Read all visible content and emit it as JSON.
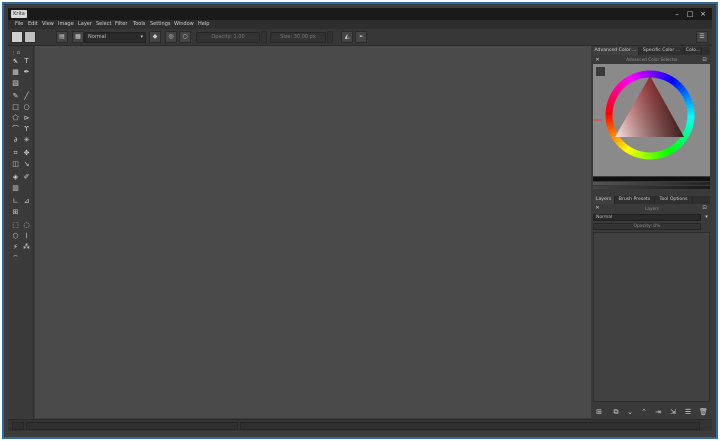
{
  "window": {
    "title": "Krita",
    "minimize_glyph": "–",
    "maximize_glyph": "□",
    "close_glyph": "×"
  },
  "menu": [
    "File",
    "Edit",
    "View",
    "Image",
    "Layer",
    "Select",
    "Filter",
    "Tools",
    "Settings",
    "Window",
    "Help"
  ],
  "toolbar": {
    "blend_mode": "Normal",
    "opacity_label": "Opacity:",
    "opacity_value": "1.00",
    "size_label": "Size:",
    "size_value": "30.00 px"
  },
  "dock_top": {
    "tabs": [
      "Advanced Color ...",
      "Specific Color ...",
      "Colo..."
    ],
    "panel_title": "Advanced Color Selector"
  },
  "dock_bottom": {
    "tabs": [
      "Layers",
      "Brush Presets",
      "Tool Options"
    ],
    "panel_title": "Layers",
    "blend_mode": "Normal",
    "opacity": "Opacity:  0%"
  },
  "colors": {
    "canvas": "#4a4a4a",
    "chrome": "#3a3a3a",
    "titlebar": "#1a1a1a",
    "frame_border": "#2d6ba0"
  },
  "icons": {
    "toolbox": [
      "select-icon",
      "text-icon",
      "gradient-icon",
      "brush-icon",
      "calligraphy-icon",
      "line-icon",
      "rectangle-icon",
      "ellipse-icon",
      "polygon-icon",
      "polyline-icon",
      "path-icon",
      "crop-icon",
      "move-icon",
      "transform-icon",
      "fill-icon",
      "eyedropper-icon",
      "assistant-icon",
      "measure-icon",
      "grid-icon",
      "rect-select-icon",
      "ellipse-select-icon",
      "freehand-select-icon",
      "magic-wand-icon",
      "similar-select-icon"
    ]
  }
}
